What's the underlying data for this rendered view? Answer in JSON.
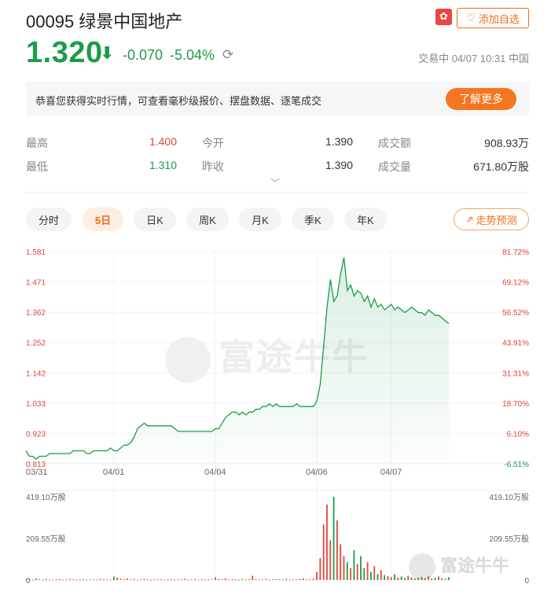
{
  "header": {
    "title": "00095 绿景中国地产",
    "market_flag_icon": "hk-flag-icon",
    "watch_button_label": "添加自选"
  },
  "quote": {
    "price": "1.320",
    "change": "-0.070",
    "change_pct": "-5.04%",
    "status": "交易中 04/07 10:31 中国"
  },
  "banner": {
    "text": "恭喜您获得实时行情，可查看毫秒级报价、摆盘数据、逐笔成交",
    "button": "了解更多"
  },
  "stats": {
    "high_label": "最高",
    "high": "1.400",
    "low_label": "最低",
    "low": "1.310",
    "open_label": "今开",
    "open": "1.390",
    "prev_close_label": "昨收",
    "prev_close": "1.390",
    "turnover_label": "成交额",
    "turnover": "908.93万",
    "volume_label": "成交量",
    "volume": "671.80万股"
  },
  "tabs": [
    {
      "label": "分时",
      "active": false
    },
    {
      "label": "5日",
      "active": true
    },
    {
      "label": "日K",
      "active": false
    },
    {
      "label": "周K",
      "active": false
    },
    {
      "label": "月K",
      "active": false
    },
    {
      "label": "季K",
      "active": false
    },
    {
      "label": "年K",
      "active": false
    }
  ],
  "trend_button": "走势预测",
  "watermark": "富途牛牛",
  "colors": {
    "up": "#e0463c",
    "down": "#1b9c4a",
    "accent": "#f06b1a"
  },
  "chart_data": {
    "type": "line",
    "title": "",
    "price_ticks": [
      "1.581",
      "1.471",
      "1.362",
      "1.252",
      "1.142",
      "1.033",
      "0.923",
      "0.813"
    ],
    "pct_ticks": [
      "81.72%",
      "69.12%",
      "56.52%",
      "43.91%",
      "31.31%",
      "18.70%",
      "6.10%",
      "-6.51%"
    ],
    "x_ticks": [
      "03/31",
      "04/01",
      "04/04",
      "04/06",
      "04/07"
    ],
    "ylim": [
      0.813,
      1.581
    ],
    "series": [
      {
        "values": [
          0.86,
          0.84,
          0.84,
          0.83,
          0.84,
          0.84,
          0.84,
          0.85,
          0.85,
          0.85,
          0.85,
          0.85,
          0.85,
          0.85,
          0.86,
          0.86,
          0.86,
          0.86,
          0.85,
          0.85,
          0.86,
          0.86,
          0.86,
          0.86,
          0.86,
          0.87,
          0.86,
          0.86,
          0.87,
          0.88,
          0.88,
          0.89,
          0.91,
          0.94,
          0.95,
          0.96,
          0.95,
          0.95,
          0.95,
          0.95,
          0.95,
          0.95,
          0.95,
          0.95,
          0.94,
          0.93,
          0.93,
          0.93,
          0.93,
          0.93,
          0.93,
          0.93,
          0.93,
          0.93,
          0.93,
          0.93,
          0.94,
          0.94,
          0.96,
          0.98,
          0.99,
          1.0,
          1.0,
          0.99,
          1.0,
          0.99,
          1.0,
          1.0,
          1.01,
          1.01,
          1.02,
          1.02,
          1.03,
          1.02,
          1.03,
          1.02,
          1.02,
          1.02,
          1.02,
          1.02,
          1.03,
          1.02,
          1.02,
          1.02,
          1.02,
          1.02,
          1.04,
          1.1,
          1.24,
          1.38,
          1.48,
          1.4,
          1.42,
          1.5,
          1.56,
          1.44,
          1.46,
          1.42,
          1.44,
          1.43,
          1.4,
          1.42,
          1.38,
          1.41,
          1.38,
          1.39,
          1.37,
          1.38,
          1.39,
          1.37,
          1.38,
          1.37,
          1.36,
          1.37,
          1.38,
          1.37,
          1.36,
          1.36,
          1.35,
          1.37,
          1.36,
          1.35,
          1.35,
          1.34,
          1.33,
          1.32
        ],
        "sessions": [
          {
            "date": "03/31",
            "start": 0,
            "end": 26
          },
          {
            "date": "04/01",
            "start": 26,
            "end": 56
          },
          {
            "date": "04/04",
            "start": 56,
            "end": 86
          },
          {
            "date": "04/06",
            "start": 86,
            "end": 108
          },
          {
            "date": "04/07",
            "start": 108,
            "end": 126
          }
        ]
      }
    ],
    "volume": {
      "ticks": [
        "419.10万股",
        "209.55万股",
        "0"
      ],
      "max": 419.1,
      "bars": [
        3,
        5,
        2,
        8,
        4,
        2,
        6,
        3,
        2,
        4,
        5,
        2,
        3,
        6,
        4,
        2,
        3,
        5,
        2,
        4,
        3,
        2,
        6,
        3,
        4,
        2,
        18,
        12,
        6,
        4,
        8,
        3,
        5,
        2,
        4,
        6,
        3,
        2,
        5,
        3,
        4,
        2,
        3,
        5,
        2,
        3,
        4,
        6,
        2,
        3,
        5,
        2,
        4,
        3,
        2,
        4,
        14,
        6,
        4,
        8,
        3,
        5,
        4,
        2,
        6,
        3,
        4,
        22,
        5,
        3,
        4,
        6,
        2,
        3,
        5,
        4,
        3,
        6,
        2,
        4,
        3,
        5,
        8,
        4,
        3,
        6,
        40,
        110,
        280,
        380,
        200,
        419,
        300,
        180,
        120,
        90,
        60,
        150,
        80,
        120,
        60,
        90,
        40,
        70,
        30,
        50,
        25,
        20,
        15,
        30,
        12,
        18,
        10,
        22,
        14,
        8,
        12,
        16,
        10,
        20,
        8,
        12,
        18,
        10,
        6,
        14
      ]
    }
  }
}
